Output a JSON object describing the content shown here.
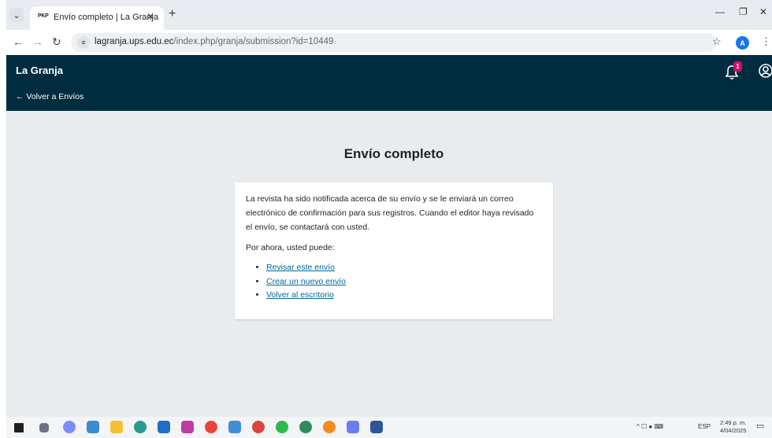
{
  "browser": {
    "tab_favicon": "PKP",
    "tab_title": "Envío completo | La Granja",
    "url_host": "lagranja.ups.edu.ec",
    "url_path": "/index.php/granja/submission?id=10449",
    "profile_initial": "A"
  },
  "header": {
    "brand": "La Granja",
    "back_link": "← Volver a Envíos",
    "notification_count": "1"
  },
  "main": {
    "title": "Envío completo",
    "message": "La revista ha sido notificada acerca de su envío y se le enviará un correo electrónico de confirmación para sus registros. Cuando el editor haya revisado el envío, se contactará con usted.",
    "prompt": "Por ahora, usted puede:",
    "links": [
      "Revisar este envío",
      "Crear un nuevo envío",
      "Volver al escritorio"
    ]
  },
  "taskbar": {
    "language": "ESP",
    "time": "2:49 p. m.",
    "date": "4/04/2025",
    "icons": [
      "windows-icon",
      "task-view-icon",
      "copilot-icon",
      "widgets-icon",
      "file-explorer-icon",
      "edge-icon",
      "outlook-icon",
      "photos-icon",
      "chrome-icon",
      "app-icon",
      "chrome-profile-icon",
      "whatsapp-icon",
      "chrome-alt-icon",
      "avast-icon",
      "app-alt-icon",
      "word-icon"
    ]
  },
  "colors": {
    "header_bg": "#002c40",
    "link": "#006798",
    "page_bg": "#e9ecef",
    "badge": "#d00a6c"
  }
}
